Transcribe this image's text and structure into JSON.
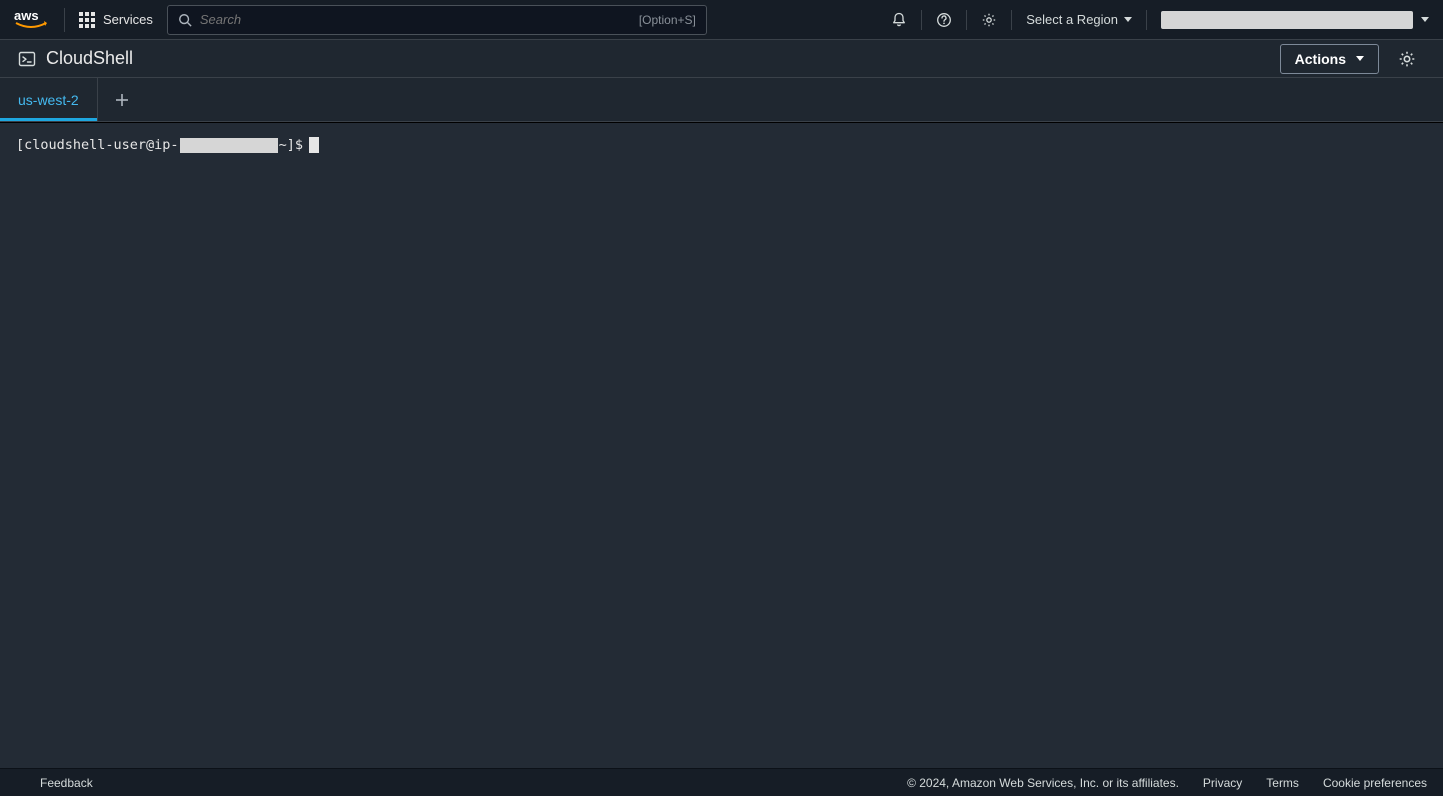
{
  "topnav": {
    "services_label": "Services",
    "search_placeholder": "Search",
    "search_hint": "[Option+S]",
    "region_label": "Select a Region"
  },
  "service": {
    "title": "CloudShell",
    "actions_label": "Actions"
  },
  "tabs": {
    "active_label": "us-west-2"
  },
  "terminal": {
    "prompt_prefix": "[cloudshell-user@ip-",
    "prompt_suffix": " ~]$"
  },
  "footer": {
    "feedback": "Feedback",
    "copyright": "© 2024, Amazon Web Services, Inc. or its affiliates.",
    "privacy": "Privacy",
    "terms": "Terms",
    "cookie": "Cookie preferences"
  }
}
